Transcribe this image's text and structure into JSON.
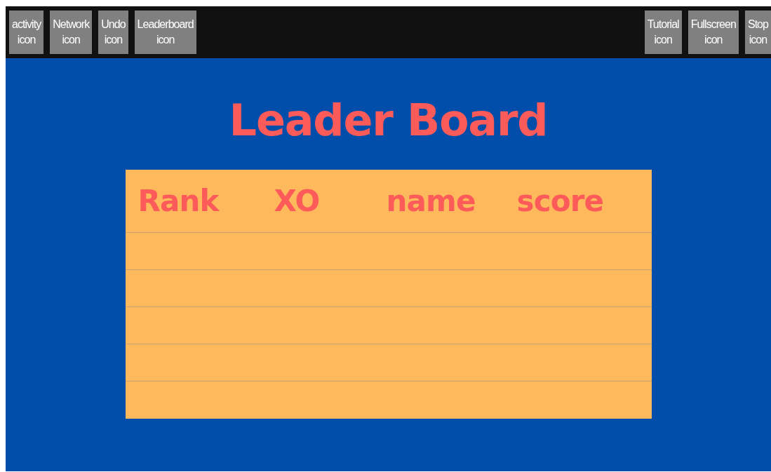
{
  "toolbar": {
    "left": [
      {
        "lines": [
          "activity",
          "icon"
        ]
      },
      {
        "lines": [
          "Network",
          "icon"
        ]
      },
      {
        "lines": [
          "Undo",
          "icon"
        ]
      },
      {
        "lines": [
          "Leaderboard",
          "icon"
        ]
      }
    ],
    "right": [
      {
        "lines": [
          "Tutorial",
          "icon"
        ]
      },
      {
        "lines": [
          "Fullscreen",
          "icon"
        ]
      },
      {
        "lines": [
          "Stop",
          "icon"
        ]
      }
    ]
  },
  "title": "Leader Board",
  "table": {
    "columns": [
      "Rank",
      "XO",
      "name",
      "score"
    ],
    "rows": [
      {
        "kind": "empty"
      },
      {
        "kind": "empty"
      },
      {
        "kind": "empty"
      },
      {
        "kind": "empty"
      },
      {
        "kind": "empty"
      }
    ]
  }
}
